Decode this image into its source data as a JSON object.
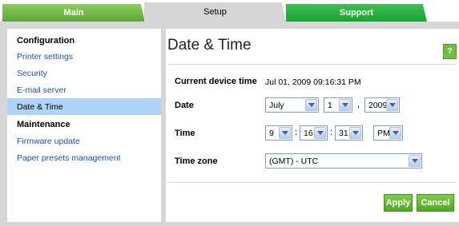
{
  "tabs": [
    {
      "label": "Main"
    },
    {
      "label": "Setup"
    },
    {
      "label": "Support"
    }
  ],
  "sidebar": {
    "items": [
      {
        "label": "Configuration",
        "kind": "heading"
      },
      {
        "label": "Printer settings",
        "kind": "link"
      },
      {
        "label": "Security",
        "kind": "link"
      },
      {
        "label": "E-mail server",
        "kind": "link"
      },
      {
        "label": "Date & Time",
        "kind": "link",
        "active": true
      },
      {
        "label": "Maintenance",
        "kind": "heading"
      },
      {
        "label": "Firmware update",
        "kind": "link"
      },
      {
        "label": "Paper presets management",
        "kind": "link"
      }
    ]
  },
  "main": {
    "title": "Date & Time",
    "help_label": "?",
    "current_time_label": "Current device time",
    "current_time_value": "Jul 01, 2009 09:16:31 PM",
    "date_label": "Date",
    "date_month": "July",
    "date_day": "1",
    "date_sep": ",",
    "date_year": "2009",
    "time_label": "Time",
    "time_hour": "9",
    "time_minute": "16",
    "time_second": "31",
    "time_sep": ":",
    "time_ampm": "PM",
    "timezone_label": "Time zone",
    "timezone_value": "(GMT) - UTC",
    "apply_label": "Apply",
    "cancel_label": "Cancel"
  },
  "colors": {
    "accent_green": "#5da63b",
    "support_green": "#18a230",
    "active_item": "#aed3f6",
    "link": "#1f4fa8"
  }
}
